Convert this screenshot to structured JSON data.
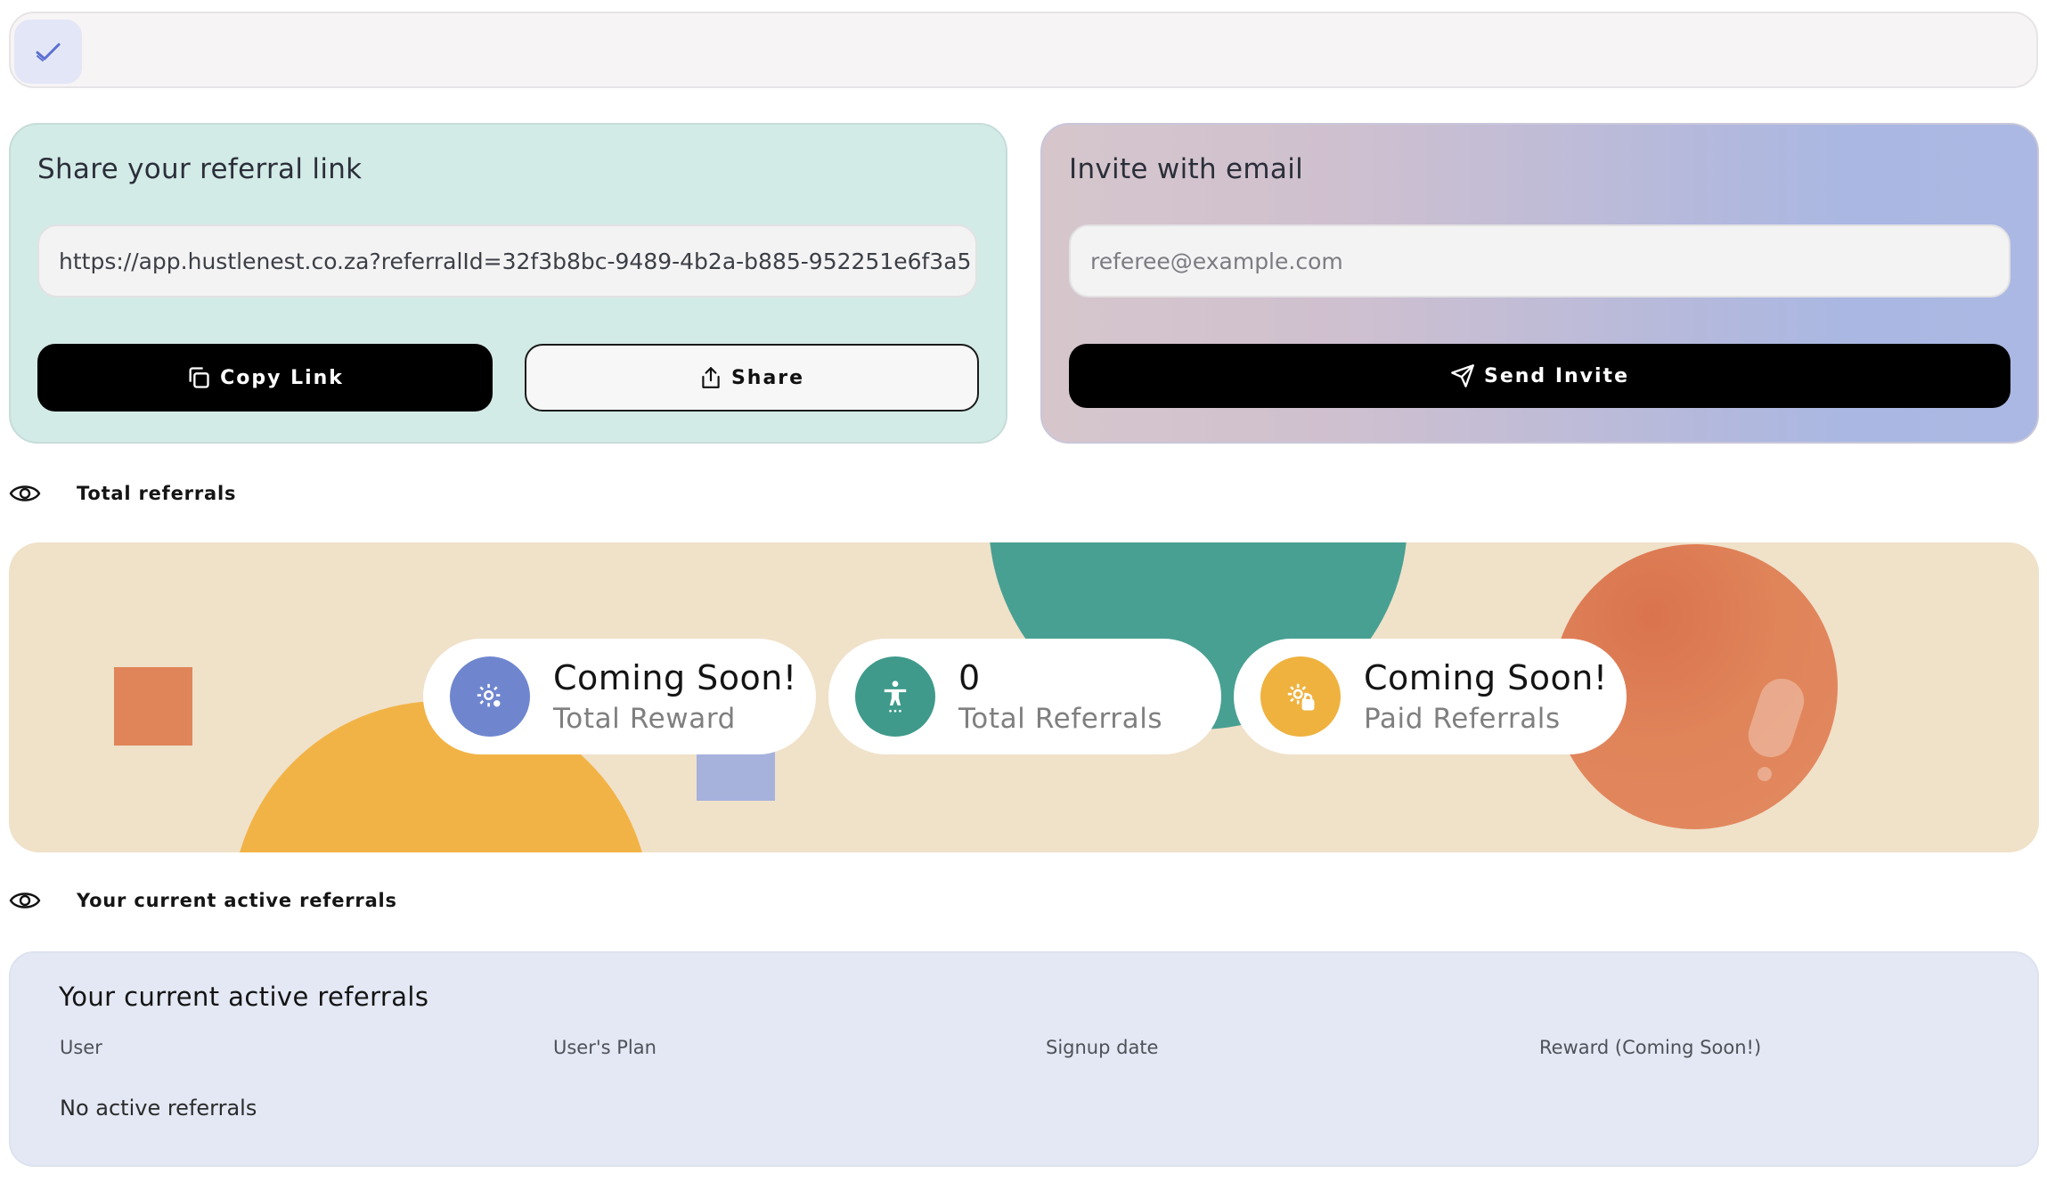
{
  "topbar": {
    "check_icon": "check-icon"
  },
  "share_card": {
    "title": "Share your referral link",
    "link_value": "https://app.hustlenest.co.za?referralId=32f3b8bc-9489-4b2a-b885-952251e6f3a5",
    "copy_label": "Copy Link",
    "share_label": "Share"
  },
  "invite_card": {
    "title": "Invite with email",
    "email_placeholder": "referee@example.com",
    "send_label": "Send Invite"
  },
  "sections": {
    "total_referrals": "Total referrals",
    "active_referrals": "Your current active referrals"
  },
  "stats": [
    {
      "value": "Coming Soon!",
      "label": "Total Reward",
      "color": "#6f86cf",
      "icon": "gear-icon"
    },
    {
      "value": "0",
      "label": "Total Referrals",
      "color": "#3f9a8b",
      "icon": "accessibility-icon"
    },
    {
      "value": "Coming Soon!",
      "label": "Paid Referrals",
      "color": "#efb23f",
      "icon": "gear-lock-icon"
    }
  ],
  "table": {
    "title": "Your current active referrals",
    "columns": [
      "User",
      "User's Plan",
      "Signup date",
      "Reward (Coming Soon!)"
    ],
    "empty_text": "No active referrals"
  },
  "colors": {
    "share_bg": "#d3ebe7",
    "banner_bg": "#f0e1c9",
    "table_bg": "#e3e8f4",
    "teal": "#48a092",
    "orange": "#e0855a",
    "yellow": "#f2b346",
    "lavender": "#a6b1dc"
  }
}
